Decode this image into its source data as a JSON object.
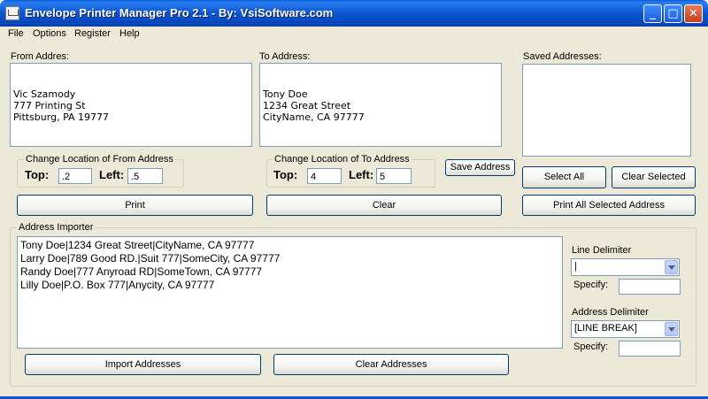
{
  "window": {
    "title": "Envelope Printer Manager Pro 2.1 - By: VsiSoftware.com",
    "minimize": "_",
    "maximize": "□",
    "close": "✕"
  },
  "menu": [
    "File",
    "Options",
    "Register",
    "Help"
  ],
  "from": {
    "label": "From Addres:",
    "lines": [
      "Vic Szamody",
      "777 Printing St",
      "Pittsburg, PA 19777"
    ]
  },
  "to": {
    "label": "To Address:",
    "lines": [
      "Tony Doe",
      "1234 Great Street",
      "CityName, CA 97777"
    ]
  },
  "saved": {
    "label": "Saved Addresses:"
  },
  "from_location": {
    "title": "Change Location of From Address",
    "top_label": "Top:",
    "top_value": ".2",
    "left_label": "Left:",
    "left_value": ".5"
  },
  "to_location": {
    "title": "Change Location of To Address",
    "top_label": "Top:",
    "top_value": "4",
    "left_label": "Left:",
    "left_value": "5"
  },
  "buttons": {
    "save_address": "Save Address",
    "select_all": "Select All",
    "clear_selected": "Clear Selected",
    "print": "Print",
    "clear": "Clear",
    "print_all_selected": "Print All Selected Address",
    "import_addresses": "Import Addresses",
    "clear_addresses": "Clear Addresses"
  },
  "importer": {
    "title": "Address Importer",
    "lines": [
      "Tony Doe|1234 Great Street|CityName, CA 97777",
      "Larry Doe|789 Good RD.|Suit 777|SomeCity, CA 97777",
      "Randy Doe|777 Anyroad RD|SomeTown, CA 97777",
      "Lilly Doe|P.O. Box 777|Anycity, CA 97777"
    ],
    "line_delimiter_label": "Line Delimiter",
    "line_delimiter_value": "|",
    "specify_label": "Specify:",
    "address_delimiter_label": "Address Delimiter",
    "address_delimiter_value": "[LINE BREAK]"
  }
}
